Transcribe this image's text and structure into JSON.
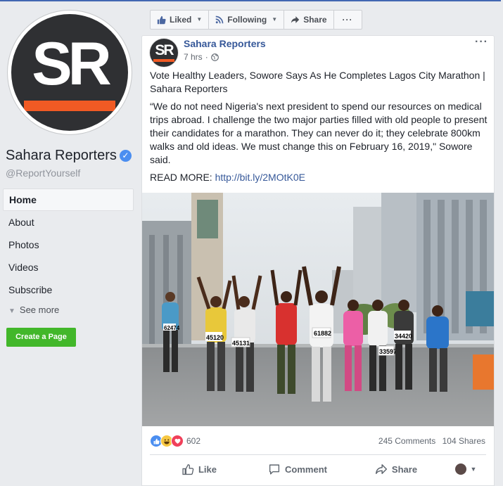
{
  "page": {
    "name": "Sahara Reporters",
    "handle": "@ReportYourself",
    "logo_text": "SR",
    "colors": {
      "brand_dark": "#2f3033",
      "brand_orange": "#f15a24",
      "link": "#365899",
      "verified": "#4b8ef0",
      "create_green": "#42b72a"
    }
  },
  "sidebar": {
    "items": [
      {
        "label": "Home",
        "active": true
      },
      {
        "label": "About"
      },
      {
        "label": "Photos"
      },
      {
        "label": "Videos"
      },
      {
        "label": "Subscribe"
      }
    ],
    "see_more": "See more",
    "create_page": "Create a Page"
  },
  "actionbar": {
    "liked": "Liked",
    "following": "Following",
    "share": "Share",
    "more": "···"
  },
  "post": {
    "author": "Sahara Reporters",
    "time": "7 hrs",
    "menu": "···",
    "title": "Vote Healthy Leaders, Sowore Says As He Completes Lagos City Marathon | Sahara Reporters",
    "body": "“We do not need Nigeria's next president to spend our resources on medical trips abroad. I challenge the two major parties filled with old people to present their candidates for a marathon. They can never do it; they celebrate 800km walks and old ideas. We must change this on February 16, 2019,\" Sowore said.",
    "read_more_label": "READ MORE: ",
    "link": "http://bit.ly/2MOtK0E",
    "reaction_count": "602",
    "comments": "245 Comments",
    "shares": "104 Shares",
    "actions": {
      "like": "Like",
      "comment": "Comment",
      "share": "Share"
    },
    "photo": {
      "bibs": [
        "62474",
        "45120",
        "45131",
        "61882",
        "33597",
        "34420"
      ]
    }
  }
}
